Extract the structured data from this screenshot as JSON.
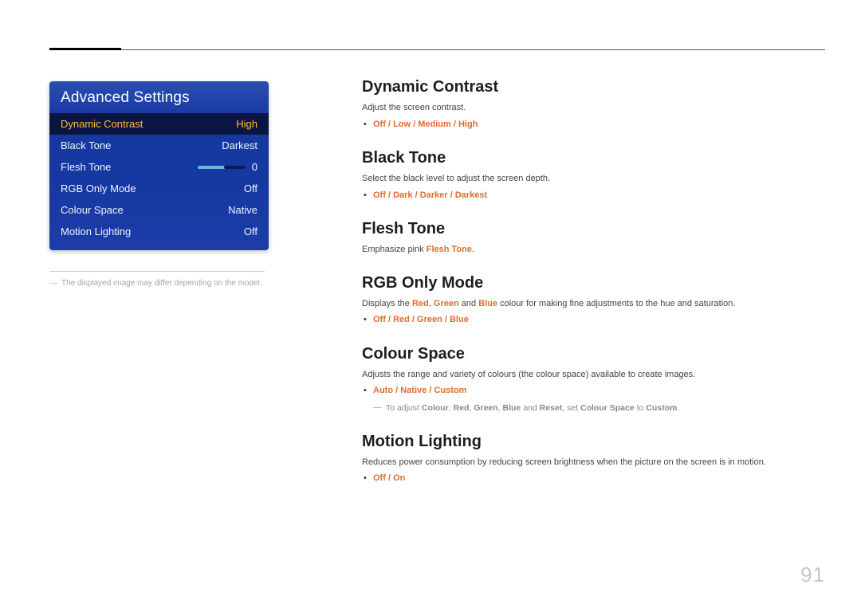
{
  "page_number": "91",
  "panel": {
    "title": "Advanced Settings",
    "rows": [
      {
        "label": "Dynamic Contrast",
        "value": "High"
      },
      {
        "label": "Black Tone",
        "value": "Darkest"
      },
      {
        "label": "Flesh Tone",
        "value": "0"
      },
      {
        "label": "RGB Only Mode",
        "value": "Off"
      },
      {
        "label": "Colour Space",
        "value": "Native"
      },
      {
        "label": "Motion Lighting",
        "value": "Off"
      }
    ]
  },
  "left_note": "The displayed image may differ depending on the model.",
  "sections": {
    "dynamic_contrast": {
      "heading": "Dynamic Contrast",
      "desc": "Adjust the screen contrast.",
      "options": [
        "Off",
        "Low",
        "Medium",
        "High"
      ]
    },
    "black_tone": {
      "heading": "Black Tone",
      "desc": "Select the black level to adjust the screen depth.",
      "options": [
        "Off",
        "Dark",
        "Darker",
        "Darkest"
      ]
    },
    "flesh_tone": {
      "heading": "Flesh Tone",
      "desc_pre": "Emphasize pink ",
      "desc_bold": "Flesh Tone",
      "desc_post": "."
    },
    "rgb_only": {
      "heading": "RGB Only Mode",
      "desc_pre": "Displays the ",
      "desc_r": "Red",
      "desc_c1": ", ",
      "desc_g": "Green",
      "desc_c2": " and ",
      "desc_b": "Blue",
      "desc_post": " colour for making fine adjustments to the hue and saturation.",
      "options": [
        "Off",
        "Red",
        "Green",
        "Blue"
      ]
    },
    "colour_space": {
      "heading": "Colour Space",
      "desc": "Adjusts the range and variety of colours (the colour space) available to create images.",
      "options": [
        "Auto",
        "Native",
        "Custom"
      ],
      "note_pre": "To adjust ",
      "note_colour": "Colour",
      "note_c1": ", ",
      "note_red": "Red",
      "note_c2": ", ",
      "note_green": "Green",
      "note_c3": ", ",
      "note_blue": "Blue",
      "note_c4": " and ",
      "note_reset": "Reset",
      "note_c5": ", set ",
      "note_cs": "Colour Space",
      "note_c6": " to ",
      "note_custom": "Custom",
      "note_post": "."
    },
    "motion_lighting": {
      "heading": "Motion Lighting",
      "desc": "Reduces power consumption by reducing screen brightness when the picture on the screen is in motion.",
      "options": [
        "Off",
        "On"
      ]
    }
  }
}
